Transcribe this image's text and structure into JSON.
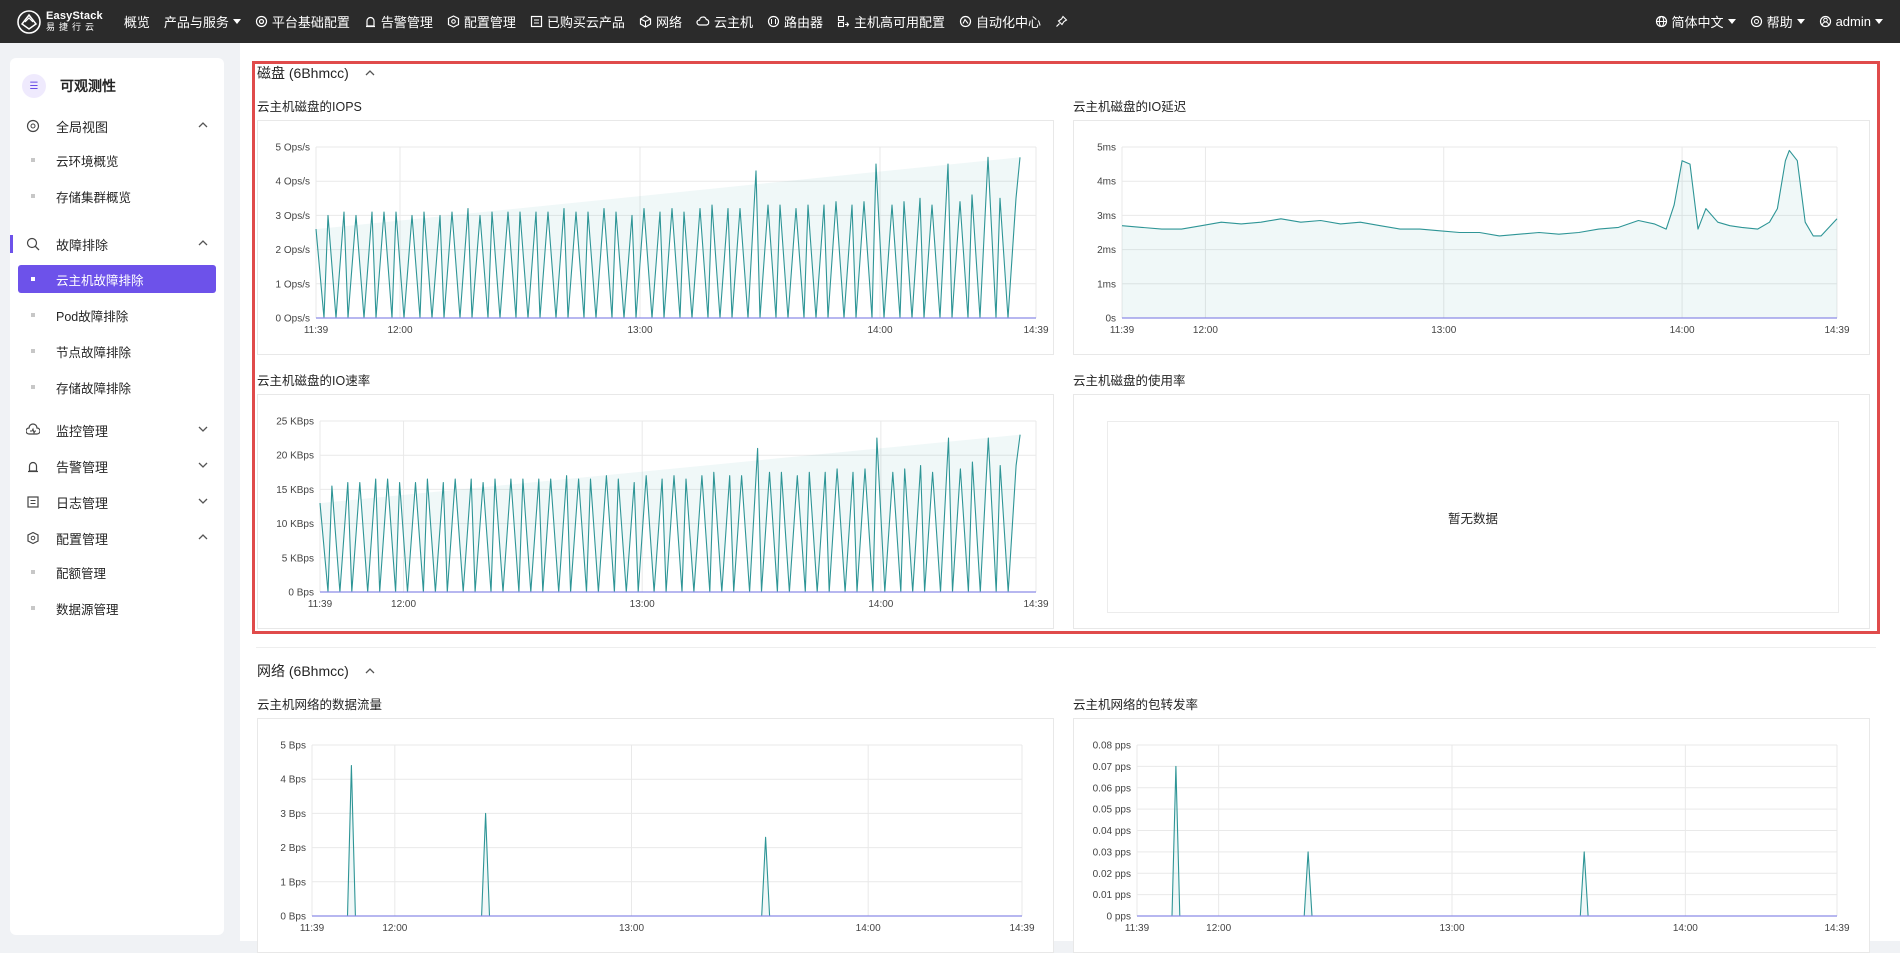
{
  "brand": {
    "name_en": "EasyStack",
    "name_cn": "易捷行云"
  },
  "topnav": {
    "items": [
      {
        "label": "概览",
        "icon": ""
      },
      {
        "label": "产品与服务",
        "icon": "",
        "dropdown": true
      },
      {
        "label": "平台基础配置",
        "icon": "settings-icon"
      },
      {
        "label": "告警管理",
        "icon": "alarm-icon"
      },
      {
        "label": "配置管理",
        "icon": "config-icon"
      },
      {
        "label": "已购买云产品",
        "icon": "list-icon"
      },
      {
        "label": "网络",
        "icon": "network-icon"
      },
      {
        "label": "云主机",
        "icon": "cloud-icon"
      },
      {
        "label": "路由器",
        "icon": "router-icon"
      },
      {
        "label": "主机高可用配置",
        "icon": "ha-icon"
      },
      {
        "label": "自动化中心",
        "icon": "automation-icon"
      }
    ],
    "right": {
      "language": "简体中文",
      "help": "帮助",
      "user": "admin"
    }
  },
  "sidebar": {
    "title": "可观测性",
    "groups": [
      {
        "label": "全局视图",
        "expanded": true,
        "items": [
          "云环境概览",
          "存储集群概览"
        ]
      },
      {
        "label": "故障排除",
        "expanded": true,
        "items": [
          "云主机故障排除",
          "Pod故障排除",
          "节点故障排除",
          "存储故障排除"
        ],
        "active_item": "云主机故障排除"
      },
      {
        "label": "监控管理",
        "expanded": false,
        "items": []
      },
      {
        "label": "告警管理",
        "expanded": false,
        "items": []
      },
      {
        "label": "日志管理",
        "expanded": false,
        "items": []
      },
      {
        "label": "配置管理",
        "expanded": true,
        "items": [
          "配额管理",
          "数据源管理"
        ]
      }
    ]
  },
  "sections": {
    "disk": {
      "title": "磁盘 (6Bhmcc)"
    },
    "network": {
      "title": "网络 (6Bhmcc)"
    }
  },
  "cards": {
    "disk_iops": {
      "title": "云主机磁盘的IOPS"
    },
    "disk_latency": {
      "title": "云主机磁盘的IO延迟"
    },
    "disk_rate": {
      "title": "云主机磁盘的IO速率"
    },
    "disk_usage": {
      "title": "云主机磁盘的使用率",
      "empty_text": "暂无数据"
    },
    "net_traffic": {
      "title": "云主机网络的数据流量"
    },
    "net_pps": {
      "title": "云主机网络的包转发率"
    }
  },
  "chart_data": [
    {
      "id": "disk_iops",
      "type": "area",
      "yticks": [
        "0 Ops/s",
        "1 Ops/s",
        "2 Ops/s",
        "3 Ops/s",
        "4 Ops/s",
        "5 Ops/s"
      ],
      "ylim": [
        0,
        5
      ],
      "xticks": [
        "11:39",
        "12:00",
        "13:00",
        "14:00",
        "14:39"
      ],
      "xrange_min": [
        0,
        180
      ],
      "xtick_min": [
        0,
        21,
        81,
        141,
        180
      ],
      "x_min": [
        0,
        2,
        3,
        5,
        7,
        8,
        10,
        12,
        14,
        15,
        17,
        19,
        20,
        22,
        24,
        26,
        27,
        29,
        31,
        32,
        34,
        36,
        38,
        39,
        41,
        43,
        44,
        46,
        48,
        50,
        51,
        53,
        55,
        56,
        58,
        60,
        62,
        63,
        65,
        67,
        68,
        70,
        72,
        74,
        75,
        77,
        79,
        80,
        82,
        84,
        86,
        87,
        89,
        91,
        92,
        94,
        96,
        98,
        99,
        101,
        103,
        104,
        106,
        108,
        110,
        111,
        113,
        115,
        116,
        118,
        120,
        122,
        123,
        125,
        127,
        128,
        130,
        132,
        134,
        135,
        137,
        139,
        140,
        142,
        144,
        146,
        147,
        149,
        151,
        152,
        154,
        156,
        158,
        159,
        161,
        163,
        164,
        166,
        168,
        170,
        171,
        173,
        175,
        176,
        178,
        180
      ],
      "values": [
        2.6,
        0,
        3.0,
        0,
        3.1,
        0,
        3.0,
        0,
        3.1,
        0,
        3.1,
        0,
        3.1,
        0,
        3.0,
        0,
        3.1,
        0,
        3.0,
        0,
        3.1,
        0,
        3.2,
        0,
        3.0,
        0,
        3.1,
        0,
        3.1,
        0,
        3.1,
        0,
        3.1,
        0,
        3.1,
        0,
        3.2,
        0,
        3.1,
        0,
        3.1,
        0,
        3.2,
        0,
        3.1,
        0,
        3.0,
        0,
        3.2,
        0,
        3.1,
        0,
        3.2,
        0,
        3.1,
        0,
        3.2,
        0,
        3.3,
        0,
        3.2,
        0,
        3.2,
        0,
        4.3,
        0,
        3.3,
        0,
        3.3,
        0,
        3.2,
        0,
        3.3,
        0,
        3.3,
        0,
        3.4,
        0,
        3.3,
        0,
        3.4,
        0,
        4.5,
        0,
        3.3,
        0,
        3.4,
        0,
        3.5,
        0,
        3.3,
        0,
        4.5,
        0,
        3.4,
        0,
        3.6,
        0,
        4.7,
        0,
        3.5,
        0,
        3.5,
        4.7
      ]
    },
    {
      "id": "disk_latency",
      "type": "area",
      "yticks": [
        "0s",
        "1ms",
        "2ms",
        "3ms",
        "4ms",
        "5ms"
      ],
      "ylim": [
        0,
        5
      ],
      "xticks": [
        "11:39",
        "12:00",
        "13:00",
        "14:00",
        "14:39"
      ],
      "xrange_min": [
        0,
        180
      ],
      "xtick_min": [
        0,
        21,
        81,
        141,
        180
      ],
      "x_min": [
        0,
        5,
        10,
        15,
        20,
        25,
        30,
        35,
        40,
        45,
        50,
        55,
        60,
        65,
        70,
        75,
        80,
        85,
        90,
        95,
        100,
        105,
        110,
        115,
        120,
        125,
        130,
        134,
        137,
        139,
        141,
        143,
        145,
        147,
        150,
        153,
        156,
        160,
        163,
        165,
        167,
        168,
        170,
        172,
        174,
        176,
        180
      ],
      "values": [
        2.7,
        2.65,
        2.6,
        2.6,
        2.7,
        2.8,
        2.75,
        2.8,
        2.9,
        2.8,
        2.85,
        2.75,
        2.8,
        2.7,
        2.6,
        2.6,
        2.55,
        2.5,
        2.5,
        2.4,
        2.45,
        2.5,
        2.45,
        2.5,
        2.6,
        2.65,
        2.85,
        2.75,
        2.6,
        3.3,
        4.6,
        4.5,
        2.6,
        3.2,
        2.8,
        2.7,
        2.65,
        2.6,
        2.8,
        3.2,
        4.6,
        4.9,
        4.6,
        2.8,
        2.4,
        2.4,
        2.9
      ]
    },
    {
      "id": "disk_rate",
      "type": "area",
      "yticks": [
        "0 Bps",
        "5 KBps",
        "10 KBps",
        "15 KBps",
        "20 KBps",
        "25 KBps"
      ],
      "ylim": [
        0,
        25
      ],
      "xticks": [
        "11:39",
        "12:00",
        "13:00",
        "14:00",
        "14:39"
      ],
      "xrange_min": [
        0,
        180
      ],
      "xtick_min": [
        0,
        21,
        81,
        141,
        180
      ],
      "x_min": [
        0,
        2,
        3,
        5,
        7,
        8,
        10,
        12,
        14,
        15,
        17,
        19,
        20,
        22,
        24,
        26,
        27,
        29,
        31,
        32,
        34,
        36,
        38,
        39,
        41,
        43,
        44,
        46,
        48,
        50,
        51,
        53,
        55,
        56,
        58,
        60,
        62,
        63,
        65,
        67,
        68,
        70,
        72,
        74,
        75,
        77,
        79,
        80,
        82,
        84,
        86,
        87,
        89,
        91,
        92,
        94,
        96,
        98,
        99,
        101,
        103,
        104,
        106,
        108,
        110,
        111,
        113,
        115,
        116,
        118,
        120,
        122,
        123,
        125,
        127,
        128,
        130,
        132,
        134,
        135,
        137,
        139,
        140,
        142,
        144,
        146,
        147,
        149,
        151,
        152,
        154,
        156,
        158,
        159,
        161,
        163,
        164,
        166,
        168,
        170,
        171,
        173,
        175,
        176,
        178,
        180
      ],
      "values": [
        13,
        0,
        15.5,
        0,
        16,
        0,
        16,
        0,
        16.5,
        0,
        16.5,
        0,
        16,
        0,
        16,
        0,
        16.5,
        0,
        16,
        0,
        16.5,
        0,
        16.5,
        0,
        16,
        0,
        16.5,
        0,
        16.5,
        0,
        16.5,
        0,
        16.5,
        0,
        16.5,
        0,
        17,
        0,
        16.5,
        0,
        16.5,
        0,
        17,
        0,
        16.5,
        0,
        16,
        0,
        17,
        0,
        16.5,
        0,
        17,
        0,
        16.5,
        0,
        17,
        0,
        17.5,
        0,
        17,
        0,
        17,
        0,
        21,
        0,
        17.5,
        0,
        17.5,
        0,
        17,
        0,
        17.5,
        0,
        17.5,
        0,
        18,
        0,
        17.5,
        0,
        18,
        0,
        22.5,
        0,
        17.5,
        0,
        18,
        0,
        18.5,
        0,
        17.5,
        0,
        22.5,
        0,
        18,
        0,
        19,
        0,
        22.5,
        0,
        18.5,
        0,
        18.5,
        23
      ]
    },
    {
      "id": "net_traffic",
      "type": "area",
      "yticks": [
        "0 Bps",
        "1 Bps",
        "2 Bps",
        "3 Bps",
        "4 Bps",
        "5 Bps"
      ],
      "ylim": [
        0,
        5
      ],
      "xticks": [
        "11:39",
        "12:00",
        "13:00",
        "14:00",
        "14:39"
      ],
      "xrange_min": [
        0,
        180
      ],
      "xtick_min": [
        0,
        21,
        81,
        141,
        180
      ],
      "x_min": [
        0,
        9,
        10,
        11,
        43,
        44,
        45,
        114,
        115,
        116,
        180
      ],
      "values": [
        0,
        0,
        4.4,
        0,
        0,
        3.0,
        0,
        0,
        2.3,
        0,
        0
      ]
    },
    {
      "id": "net_pps",
      "type": "area",
      "yticks": [
        "0 pps",
        "0.01 pps",
        "0.02 pps",
        "0.03 pps",
        "0.04 pps",
        "0.05 pps",
        "0.06 pps",
        "0.07 pps",
        "0.08 pps"
      ],
      "ylim": [
        0,
        0.08
      ],
      "xticks": [
        "11:39",
        "12:00",
        "13:00",
        "14:00",
        "14:39"
      ],
      "xrange_min": [
        0,
        180
      ],
      "xtick_min": [
        0,
        21,
        81,
        141,
        180
      ],
      "x_min": [
        0,
        9,
        10,
        11,
        43,
        44,
        45,
        114,
        115,
        116,
        180
      ],
      "values": [
        0,
        0,
        0.07,
        0,
        0,
        0.03,
        0,
        0,
        0.03,
        0,
        0
      ]
    }
  ],
  "colors": {
    "topbar": "#2b2b2b",
    "accent": "#6d52ea",
    "series": "#2e9596",
    "highlight": "#e04b4b"
  }
}
